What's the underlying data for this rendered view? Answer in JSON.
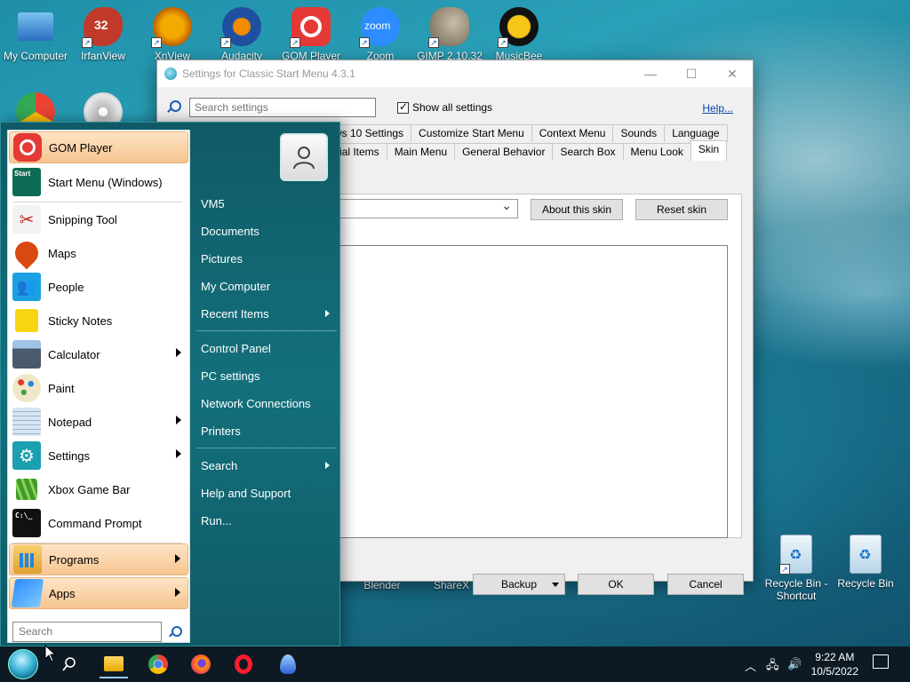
{
  "desktop": {
    "icons_top": [
      {
        "label": "My Computer",
        "name": "my-computer-icon",
        "color": "#3a86d6"
      },
      {
        "label": "IrfanView",
        "name": "irfanview-icon",
        "color": "#c0392b",
        "badge": "32"
      },
      {
        "label": "XnView",
        "name": "xnview-icon",
        "color": "#f2a900"
      },
      {
        "label": "Audacity",
        "name": "audacity-icon",
        "color": "#1f4fa0"
      },
      {
        "label": "GOM Player",
        "name": "gom-player-icon",
        "color": "#e53935"
      },
      {
        "label": "Zoom",
        "name": "zoom-icon",
        "color": "#2d8cff"
      },
      {
        "label": "GIMP 2.10.32",
        "name": "gimp-icon",
        "color": "#8a7a66"
      },
      {
        "label": "MusicBee",
        "name": "musicbee-icon",
        "color": "#f5c518"
      }
    ],
    "icons_bottom": [
      {
        "label": "Blender",
        "name": "blender-icon"
      },
      {
        "label": "ShareX",
        "name": "sharex-icon"
      },
      {
        "label": "Recycle Bin - Shortcut",
        "name": "recycle-bin-shortcut-icon"
      },
      {
        "label": "Recycle Bin",
        "name": "recycle-bin-icon"
      }
    ]
  },
  "settings_window": {
    "title": "Settings for Classic Start Menu 4.3.1",
    "search_placeholder": "Search settings",
    "show_all_label": "Show all settings",
    "help_link": "Help...",
    "tabs_row1": [
      "ws 10 Settings",
      "Customize Start Menu",
      "Context Menu",
      "Sounds",
      "Language"
    ],
    "tabs_row2": [
      "cial Items",
      "Main Menu",
      "General Behavior",
      "Search Box",
      "Menu Look",
      "Skin"
    ],
    "selected_tab": "Skin",
    "about_skin_button": "About this skin",
    "reset_skin_button": "Reset skin",
    "backup_button": "Backup",
    "ok_button": "OK",
    "cancel_button": "Cancel"
  },
  "start_menu": {
    "left_items": [
      {
        "label": "GOM Player",
        "icon": "gom-player-icon",
        "highlight": true,
        "color": "#e53935",
        "arrow": false
      },
      {
        "label": "Start Menu (Windows)",
        "icon": "start-menu-icon",
        "color": "#0e6b55",
        "arrow": false
      },
      {
        "label": "Snipping Tool",
        "icon": "scissors-icon",
        "color": "#f3f3f3",
        "arrow": false
      },
      {
        "label": "Maps",
        "icon": "map-pin-icon",
        "color": "#d9480f",
        "arrow": false
      },
      {
        "label": "People",
        "icon": "people-icon",
        "color": "#1ba1e2",
        "arrow": false
      },
      {
        "label": "Sticky Notes",
        "icon": "sticky-note-icon",
        "color": "#f7d511",
        "arrow": false
      },
      {
        "label": "Calculator",
        "icon": "calculator-icon",
        "color": "#4a5a6a",
        "arrow": true
      },
      {
        "label": "Paint",
        "icon": "palette-icon",
        "color": "#f0e6c8",
        "arrow": false
      },
      {
        "label": "Notepad",
        "icon": "notepad-icon",
        "color": "#d8e6f2",
        "arrow": true
      },
      {
        "label": "Settings",
        "icon": "gear-icon",
        "color": "#1c9fb0",
        "arrow": true
      },
      {
        "label": "Xbox Game Bar",
        "icon": "xbox-icon",
        "color": "#3d9b2f",
        "arrow": false
      },
      {
        "label": "Command Prompt",
        "icon": "terminal-icon",
        "color": "#111111",
        "arrow": false
      }
    ],
    "programs_label": "Programs",
    "apps_label": "Apps",
    "search_placeholder": "Search",
    "right_items": [
      {
        "label": "VM5",
        "arrow": false
      },
      {
        "label": "Documents",
        "arrow": false
      },
      {
        "label": "Pictures",
        "arrow": false
      },
      {
        "label": "My Computer",
        "arrow": false
      },
      {
        "label": "Recent Items",
        "arrow": true
      },
      {
        "label": "Control Panel",
        "arrow": false
      },
      {
        "label": "PC settings",
        "arrow": false
      },
      {
        "label": "Network Connections",
        "arrow": false
      },
      {
        "label": "Printers",
        "arrow": false
      },
      {
        "label": "Search",
        "arrow": true
      },
      {
        "label": "Help and Support",
        "arrow": false
      },
      {
        "label": "Run...",
        "arrow": false
      }
    ]
  },
  "taskbar": {
    "time": "9:22 AM",
    "date": "10/5/2022",
    "apps": [
      "start-orb-icon",
      "search-icon",
      "file-explorer-icon",
      "chrome-icon",
      "firefox-icon",
      "opera-icon",
      "app-flame-icon"
    ]
  }
}
